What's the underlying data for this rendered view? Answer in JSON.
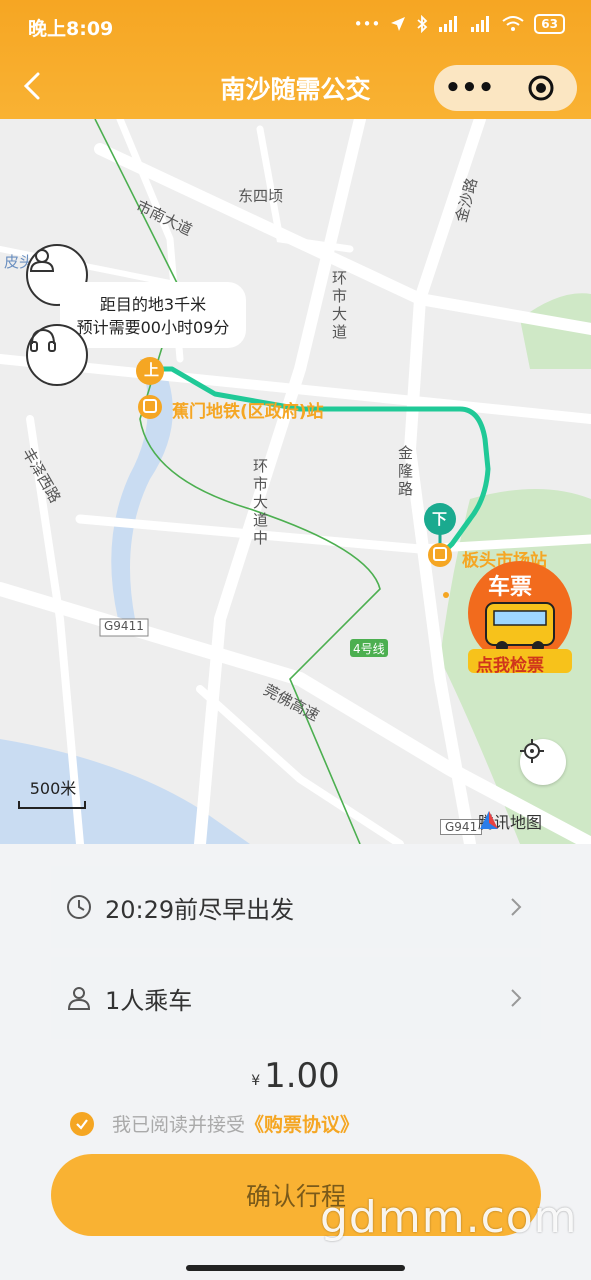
{
  "status_bar": {
    "time": "晚上8:09",
    "battery": "63",
    "signal_icons": [
      "dots-icon",
      "location-icon",
      "bluetooth-icon",
      "signal-icon",
      "hd-signal-icon",
      "wifi-icon"
    ]
  },
  "navbar": {
    "title": "南沙随需公交",
    "more_label": "•••"
  },
  "map": {
    "tooltip_line1": "距目的地3千米",
    "tooltip_line2": "预计需要00小时09分",
    "board_badge": "上",
    "alight_badge": "下",
    "board_stop": "蕉门地铁(区政府)站",
    "alight_stop": "板头市场站",
    "labels": {
      "dongsiqing": "东四顷",
      "shinan": "市南大道",
      "jinsha": "金沙路",
      "huanshi": "环市大道",
      "huanshi_zhong": "环市大道中",
      "feng": "丰泽西路",
      "jinlong": "金隆路",
      "pitou": "皮头",
      "g9411": "G9411",
      "line4": "4号线",
      "guanfo": "莞佛高速",
      "g941": "G941"
    },
    "ticket_top": "车票",
    "ticket_bottom": "点我检票",
    "scale": "500米",
    "provider": "腾讯地图",
    "route_color": "#20c997",
    "accent_color": "#f5a623"
  },
  "trip": {
    "departure": "20:29前尽早出发",
    "passengers": "1人乘车",
    "currency": "¥",
    "price": "1.00",
    "agree_text": "我已阅读并接受",
    "agreement_link": "《购票协议》",
    "confirm": "确认行程"
  },
  "watermark": "gdmm.com"
}
